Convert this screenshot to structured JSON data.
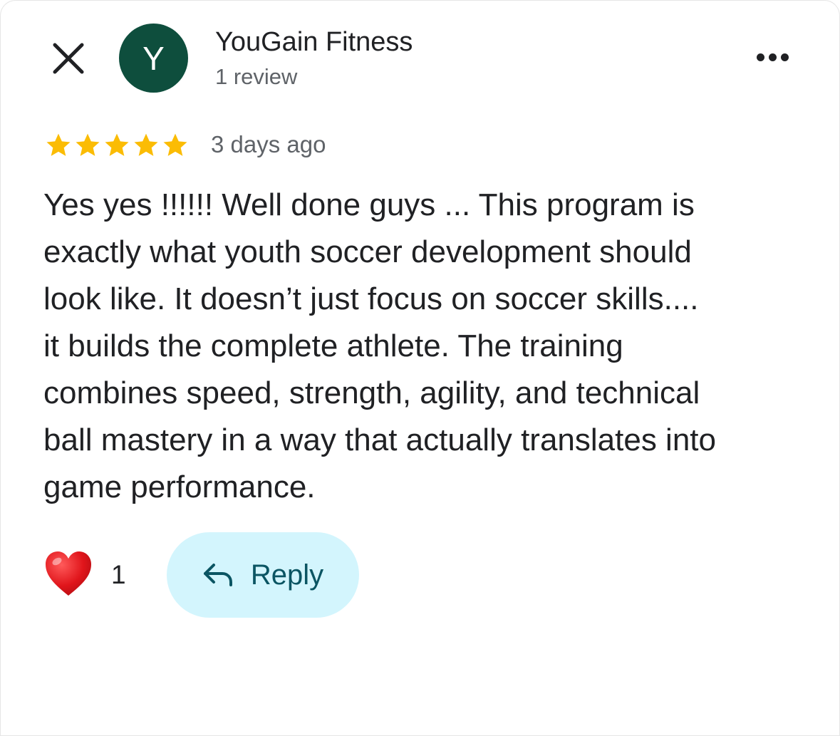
{
  "header": {
    "close_icon": "close-icon",
    "avatar_letter": "Y",
    "avatar_color": "#0e4e3d",
    "author_name": "YouGain Fitness",
    "author_review_count": "1 review",
    "more_icon": "more-horizontal-icon"
  },
  "review": {
    "rating": 5,
    "max_rating": 5,
    "star_color": "#fbbc04",
    "time": "3 days ago",
    "text": "Yes yes !!!!!!   Well done guys ... This program is\nexactly what youth soccer development should\nlook like. It doesn’t just focus on soccer skills....\nit builds the complete athlete. The training\ncombines speed, strength, agility, and technical\nball mastery in a way that actually translates into\ngame performance."
  },
  "actions": {
    "reaction_icon": "heart-icon",
    "reaction_count": "1",
    "reply_icon": "reply-arrow-icon",
    "reply_label": "Reply",
    "reply_bg_color": "#d3f5fd"
  }
}
